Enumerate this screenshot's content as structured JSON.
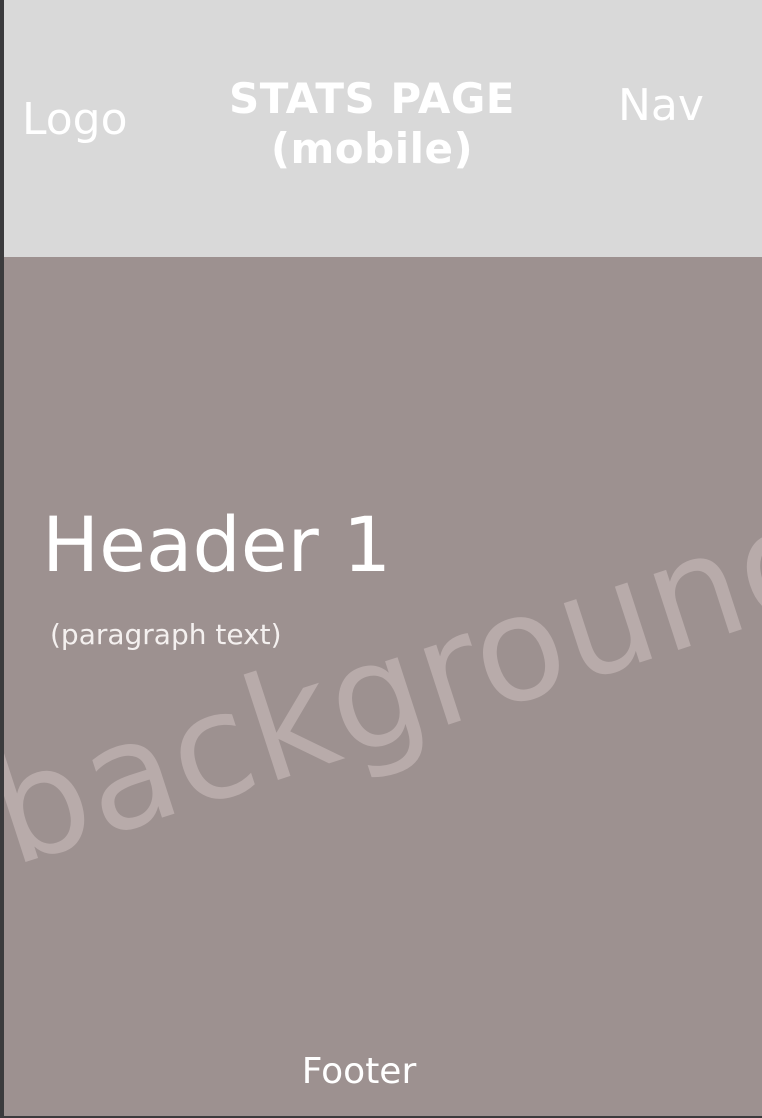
{
  "header": {
    "logo": "Logo",
    "title_line1": "STATS PAGE",
    "title_line2": "(mobile)",
    "nav": "Nav"
  },
  "main": {
    "heading": "Header 1",
    "paragraph": "(paragraph text)",
    "background_label": "background"
  },
  "footer": {
    "label": "Footer"
  },
  "colors": {
    "topbar": "#d9d9d9",
    "main_background": "#9d9190",
    "text": "#ffffff"
  }
}
